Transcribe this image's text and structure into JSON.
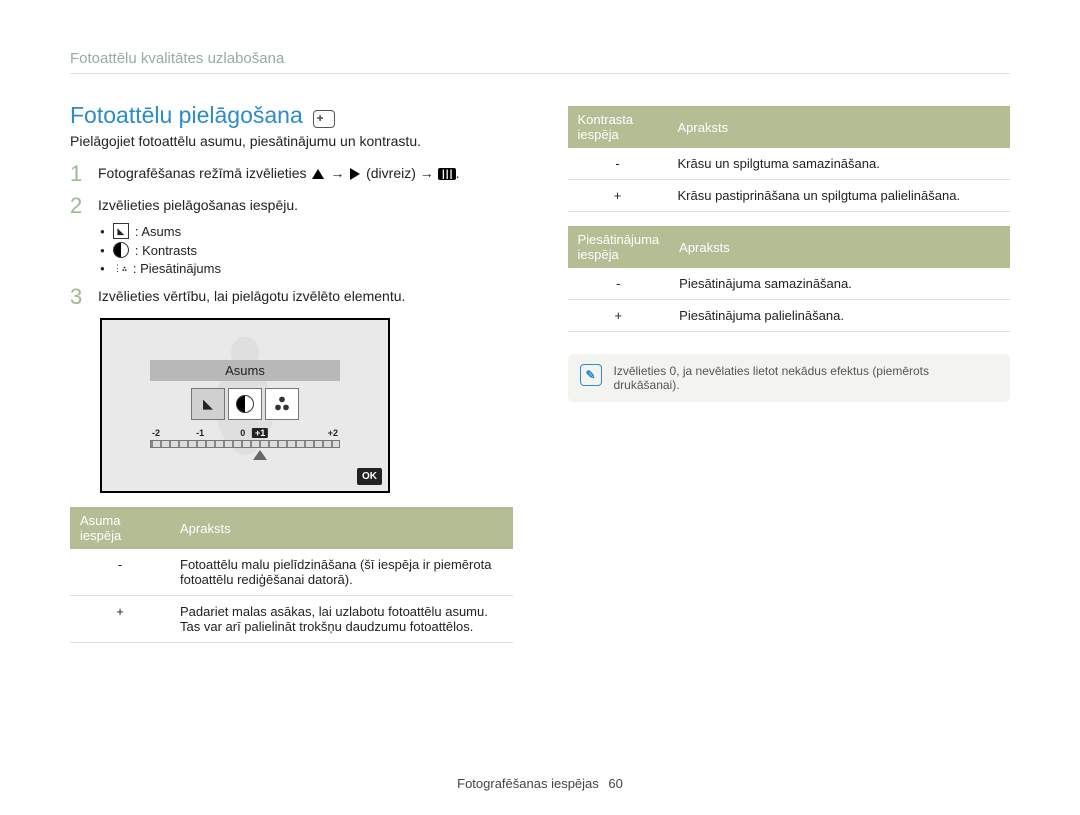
{
  "header": "Fotoattēlu kvalitātes uzlabošana",
  "title": "Fotoattēlu pielāgošana",
  "intro": "Pielāgojiet fotoattēlu asumu, piesātinājumu un kontrastu.",
  "steps": {
    "s1_a": "Fotografēšanas režīmā izvēlieties",
    "s1_b": "(divreiz)",
    "s2": "Izvēlieties pielāgošanas iespēju.",
    "s3": "Izvēlieties vērtību, lai pielāgotu izvēlēto elementu."
  },
  "bullets": {
    "b1": ": Asums",
    "b2": ": Kontrasts",
    "b3": ": Piesātinājums"
  },
  "screenshot": {
    "label": "Asums",
    "ticks": [
      "-2",
      "-1",
      "0",
      "+1",
      "+2"
    ],
    "selected": "+1",
    "ok": "OK"
  },
  "tables": {
    "sharp": {
      "h1": "Asuma iespēja",
      "h2": "Apraksts",
      "r1s": "-",
      "r1d": "Fotoattēlu malu pielīdzināšana (šī iespēja ir piemērota fotoattēlu rediģēšanai datorā).",
      "r2s": "+",
      "r2d": "Padariet malas asākas, lai uzlabotu fotoattēlu asumu. Tas var arī palielināt trokšņu daudzumu fotoattēlos."
    },
    "contrast": {
      "h1": "Kontrasta iespēja",
      "h2": "Apraksts",
      "r1s": "-",
      "r1d": "Krāsu un spilgtuma samazināšana.",
      "r2s": "+",
      "r2d": "Krāsu pastiprināšana un spilgtuma palielināšana."
    },
    "saturation": {
      "h1": "Piesātinājuma iespēja",
      "h2": "Apraksts",
      "r1s": "-",
      "r1d": "Piesātinājuma samazināšana.",
      "r2s": "+",
      "r2d": "Piesātinājuma palielināšana."
    }
  },
  "note": "Izvēlieties 0, ja nevēlaties lietot nekādus efektus (piemērots drukāšanai).",
  "footer": {
    "section": "Fotografēšanas iespējas",
    "page": "60"
  },
  "chart_data": {
    "type": "table",
    "tables": [
      {
        "title": "Asuma iespēja",
        "columns": [
          "Asuma iespēja",
          "Apraksts"
        ],
        "rows": [
          [
            "-",
            "Fotoattēlu malu pielīdzināšana (šī iespēja ir piemērota fotoattēlu rediģēšanai datorā)."
          ],
          [
            "+",
            "Padariet malas asākas, lai uzlabotu fotoattēlu asumu. Tas var arī palielināt trokšņu daudzumu fotoattēlos."
          ]
        ]
      },
      {
        "title": "Kontrasta iespēja",
        "columns": [
          "Kontrasta iespēja",
          "Apraksts"
        ],
        "rows": [
          [
            "-",
            "Krāsu un spilgtuma samazināšana."
          ],
          [
            "+",
            "Krāsu pastiprināšana un spilgtuma palielināšana."
          ]
        ]
      },
      {
        "title": "Piesātinājuma iespēja",
        "columns": [
          "Piesātinājuma iespēja",
          "Apraksts"
        ],
        "rows": [
          [
            "-",
            "Piesātinājuma samazināšana."
          ],
          [
            "+",
            "Piesātinājuma palielināšana."
          ]
        ]
      }
    ],
    "adjustment_slider": {
      "parameter": "Asums",
      "range": [
        -2,
        -1,
        0,
        1,
        2
      ],
      "selected": 1
    }
  }
}
